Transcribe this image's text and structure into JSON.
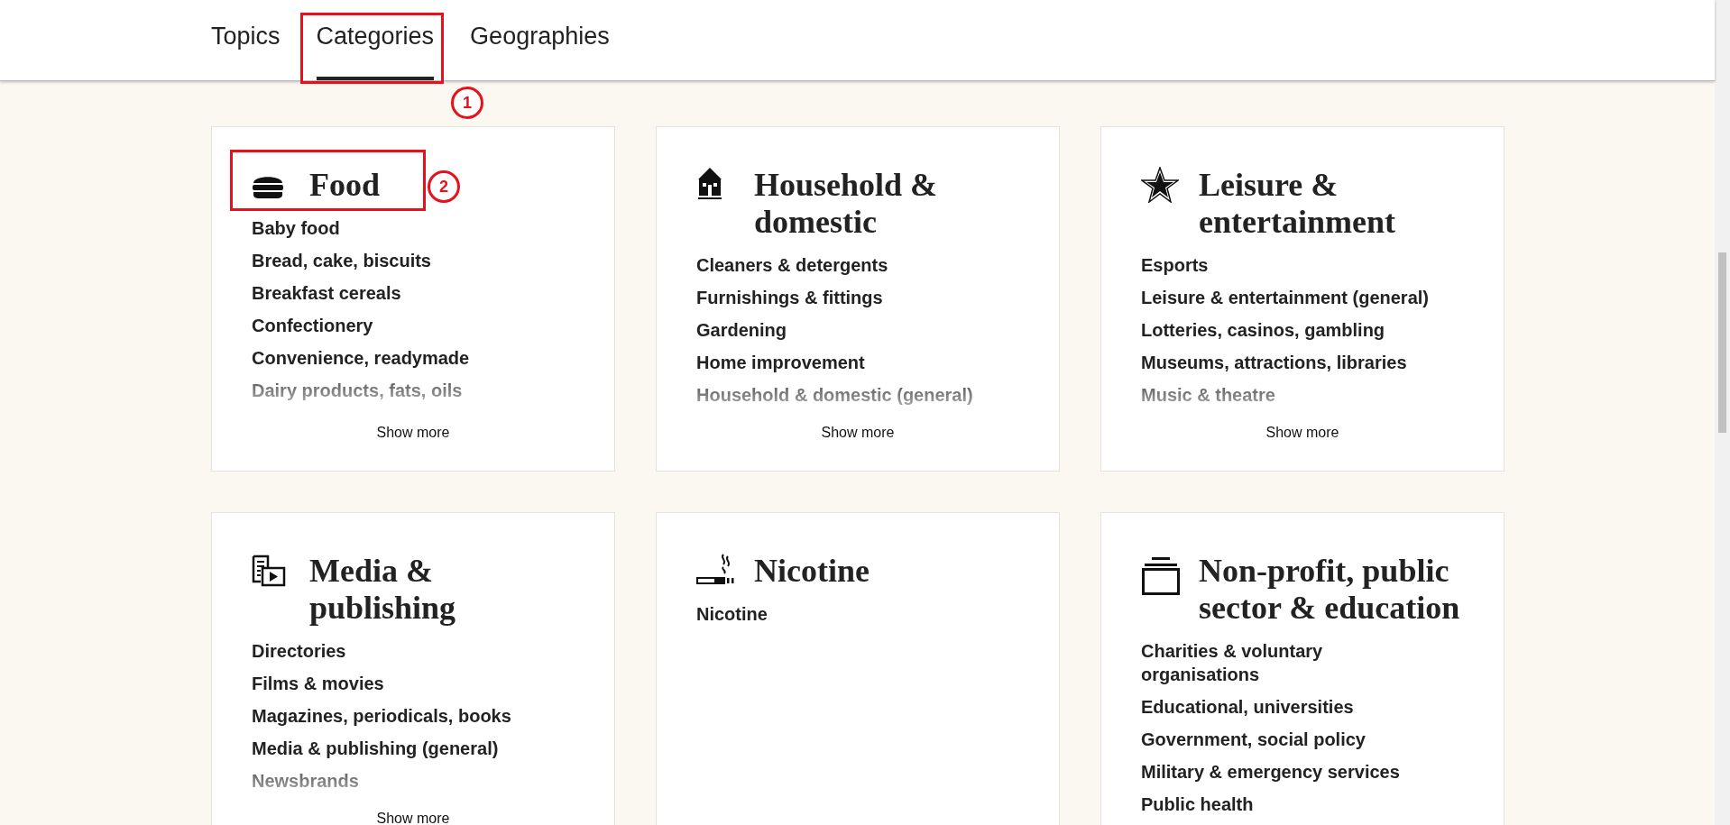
{
  "tabs": [
    {
      "label": "Topics",
      "selected": false
    },
    {
      "label": "Categories",
      "selected": true,
      "callout": "1"
    },
    {
      "label": "Geographies",
      "selected": false
    }
  ],
  "cards": [
    {
      "kind": "burger",
      "title": "Food",
      "callout": "2",
      "items": [
        {
          "label": "Baby food",
          "faded": false
        },
        {
          "label": "Bread, cake, biscuits",
          "faded": false
        },
        {
          "label": "Breakfast cereals",
          "faded": false
        },
        {
          "label": "Confectionery",
          "faded": false
        },
        {
          "label": "Convenience, readymade",
          "faded": false
        },
        {
          "label": "Dairy products, fats, oils",
          "faded": true
        }
      ],
      "show_more": "Show more"
    },
    {
      "kind": "house",
      "title": "Household & domestic",
      "items": [
        {
          "label": "Cleaners & detergents",
          "faded": false
        },
        {
          "label": "Furnishings & fittings",
          "faded": false
        },
        {
          "label": "Gardening",
          "faded": false
        },
        {
          "label": "Home improvement",
          "faded": false
        },
        {
          "label": "Household & domestic (general)",
          "faded": true
        }
      ],
      "show_more": "Show more"
    },
    {
      "kind": "star",
      "title": "Leisure & entertainment",
      "items": [
        {
          "label": "Esports",
          "faded": false
        },
        {
          "label": "Leisure & entertainment (general)",
          "faded": false
        },
        {
          "label": "Lotteries, casinos, gambling",
          "faded": false
        },
        {
          "label": "Museums, attractions, libraries",
          "faded": false
        },
        {
          "label": "Music & theatre",
          "faded": true
        }
      ],
      "show_more": "Show more"
    },
    {
      "kind": "media",
      "title": "Media & publishing",
      "items": [
        {
          "label": "Directories",
          "faded": false
        },
        {
          "label": "Films & movies",
          "faded": false
        },
        {
          "label": "Magazines, periodicals, books",
          "faded": false
        },
        {
          "label": "Media & publishing (general)",
          "faded": false
        },
        {
          "label": "Newsbrands",
          "faded": true
        }
      ],
      "show_more": "Show more"
    },
    {
      "kind": "cigarette",
      "title": "Nicotine",
      "items": [
        {
          "label": "Nicotine",
          "faded": false
        }
      ]
    },
    {
      "kind": "stack",
      "title": "Non-profit, public sector & education",
      "items": [
        {
          "label": "Charities & voluntary organisations",
          "faded": false
        },
        {
          "label": "Educational, universities",
          "faded": false
        },
        {
          "label": "Government, social policy",
          "faded": false
        },
        {
          "label": "Military & emergency services",
          "faded": false
        },
        {
          "label": "Public health",
          "faded": false
        }
      ]
    }
  ]
}
